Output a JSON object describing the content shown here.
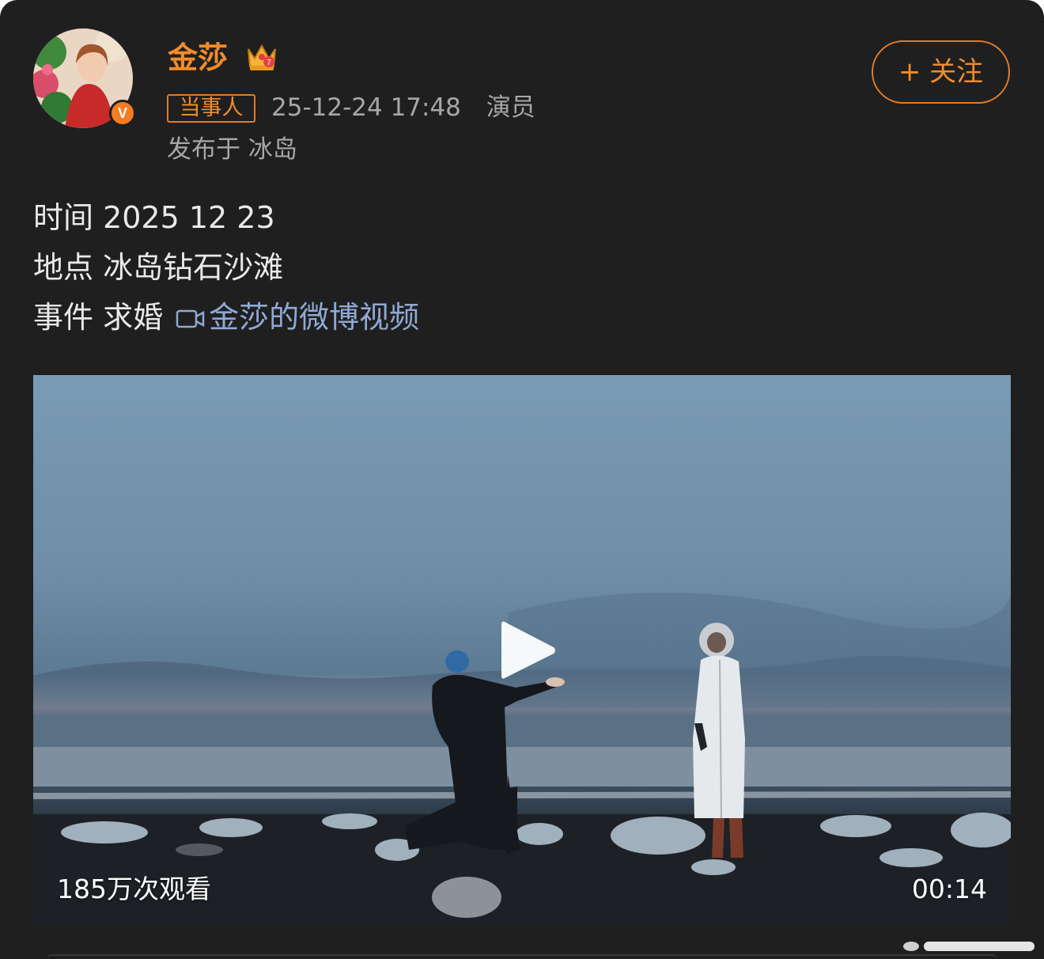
{
  "post": {
    "author": {
      "name": "金莎",
      "verified_mark": "V",
      "crown_icon": "crown-icon",
      "badge": "当事人"
    },
    "timestamp": "25-12-24 17:48",
    "role": "演员",
    "location": "发布于 冰岛",
    "follow_label": "+ 关注",
    "lines": [
      "时间 2025 12 23",
      "地点 冰岛钻石沙滩",
      "事件 求婚"
    ],
    "video_link": "金莎的微博视频"
  },
  "video": {
    "views": "185万次观看",
    "duration": "00:14",
    "play_icon": "play-icon"
  },
  "colors": {
    "background": "#1f1f1f",
    "accent": "#f08c2c",
    "link": "#8fa9d4",
    "text": "#e9e9e9",
    "meta": "#a7a7a7"
  }
}
